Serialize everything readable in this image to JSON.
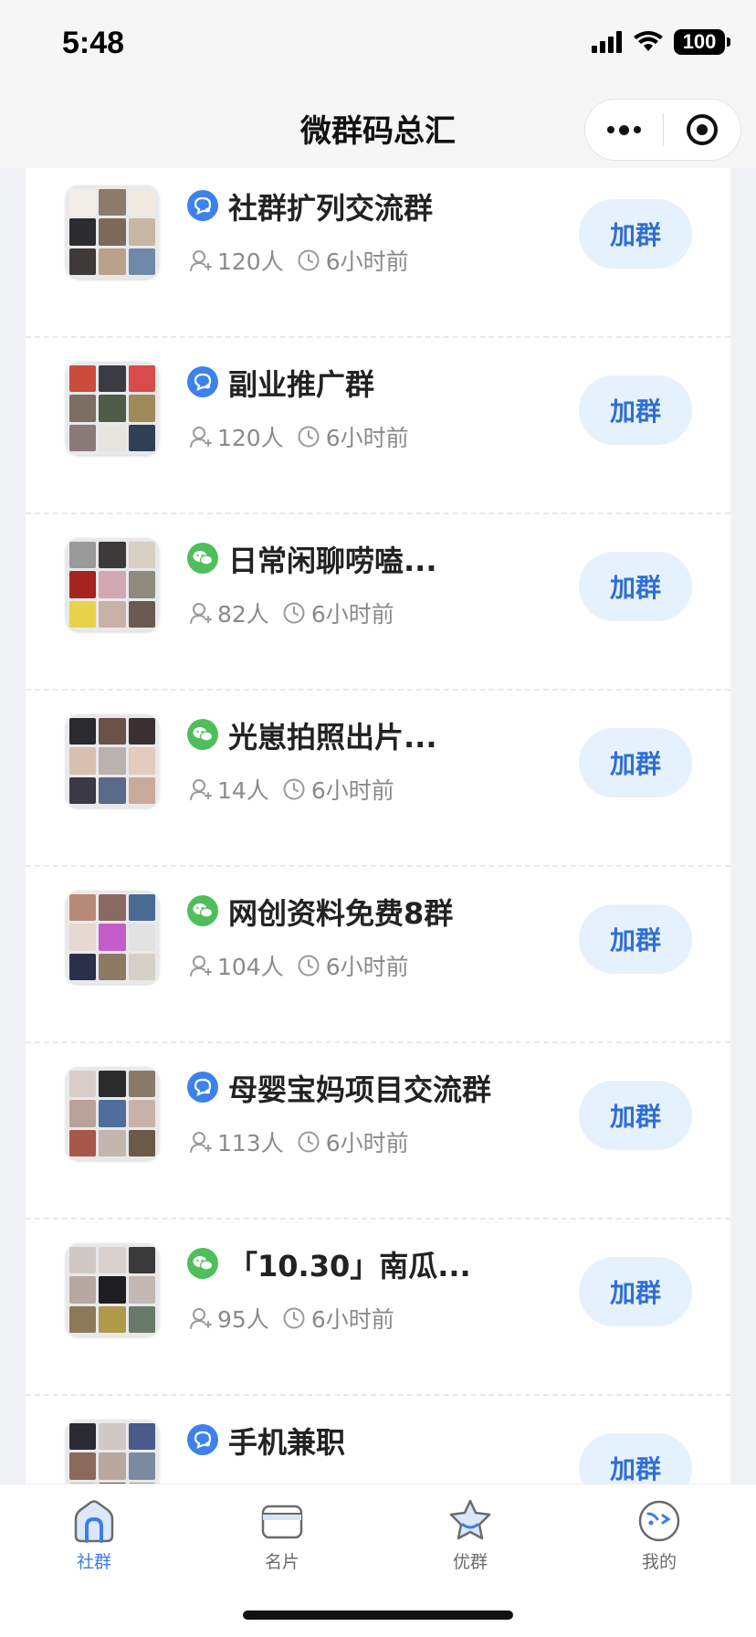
{
  "status_bar": {
    "time": "5:48",
    "battery": "100"
  },
  "nav": {
    "title": "微群码总汇"
  },
  "groups": [
    {
      "name": "社群扩列交流群",
      "type": "community",
      "members": "120人",
      "time": "6小时前",
      "join": "加群",
      "colors": [
        "#f3efe8",
        "#8d7b6a",
        "#f1e9e0",
        "#2b2b30",
        "#7b6a58",
        "#c7b7a4",
        "#3e3a3a",
        "#b9a18a",
        "#6f8aa8"
      ]
    },
    {
      "name": "副业推广群",
      "type": "community",
      "members": "120人",
      "time": "6小时前",
      "join": "加群",
      "colors": [
        "#c94d3a",
        "#3b3b44",
        "#d84b4b",
        "#7a6f62",
        "#4d5b48",
        "#a08a5a",
        "#8a7a7a",
        "#e8e4e0",
        "#2f3f55"
      ]
    },
    {
      "name": "日常闲聊唠嗑...",
      "type": "wechat",
      "members": "82人",
      "time": "6小时前",
      "join": "加群",
      "colors": [
        "#9a9a9a",
        "#3c3a38",
        "#d8d0c2",
        "#a5231f",
        "#d3a8b2",
        "#8e8a7c",
        "#e6d34a",
        "#c9b1a8",
        "#6a5a52"
      ]
    },
    {
      "name": "光崽拍照出片...",
      "type": "wechat",
      "members": "14人",
      "time": "6小时前",
      "join": "加群",
      "colors": [
        "#2a2a2e",
        "#6a5248",
        "#3a3032",
        "#d8c0b0",
        "#b9b2ae",
        "#e3cbbd",
        "#3b3a44",
        "#5a6a8a",
        "#c9a99a"
      ]
    },
    {
      "name": "网创资料免费8群",
      "type": "wechat",
      "members": "104人",
      "time": "6小时前",
      "join": "加群",
      "colors": [
        "#b78a78",
        "#8a6a5e",
        "#4a6a94",
        "#e7d8d2",
        "#c45cc9",
        "#e2e2e2",
        "#2a2f4a",
        "#8a7a62",
        "#d4d0c8"
      ]
    },
    {
      "name": "母婴宝妈项目交流群",
      "type": "community",
      "members": "113人",
      "time": "6小时前",
      "join": "加群",
      "colors": [
        "#d9cfc8",
        "#2b2b2b",
        "#8a7a68",
        "#b9a29a",
        "#4f6f9a",
        "#c8b2a8",
        "#a8574a",
        "#c2b6ad",
        "#6a5a48"
      ]
    },
    {
      "name": "「10.30」南瓜...",
      "type": "wechat",
      "members": "95人",
      "time": "6小时前",
      "join": "加群",
      "colors": [
        "#cfc8c4",
        "#d8d2ce",
        "#3a3a3a",
        "#b7a9a2",
        "#1f1f22",
        "#c3b8b2",
        "#8a7a5a",
        "#b09a4a",
        "#6a7a6a"
      ]
    },
    {
      "name": "手机兼职",
      "type": "community",
      "members": "",
      "time": "",
      "join": "加群",
      "colors": [
        "#2a2a34",
        "#d0c8c2",
        "#4a5a8a",
        "#8a6a5a",
        "#b8a8a0",
        "#7a8aa0",
        "#c8b8ae",
        "#5a4a42",
        "#a09890"
      ]
    }
  ],
  "tabs": [
    {
      "label": "社群",
      "icon": "home-icon",
      "active": true
    },
    {
      "label": "名片",
      "icon": "card-icon",
      "active": false
    },
    {
      "label": "优群",
      "icon": "star-icon",
      "active": false
    },
    {
      "label": "我的",
      "icon": "profile-icon",
      "active": false
    }
  ],
  "colors": {
    "accent": "#3b7ee8",
    "join_bg": "#e6f1fe",
    "community_icon": "#3d82ec",
    "wechat_icon": "#4ebf5a"
  }
}
